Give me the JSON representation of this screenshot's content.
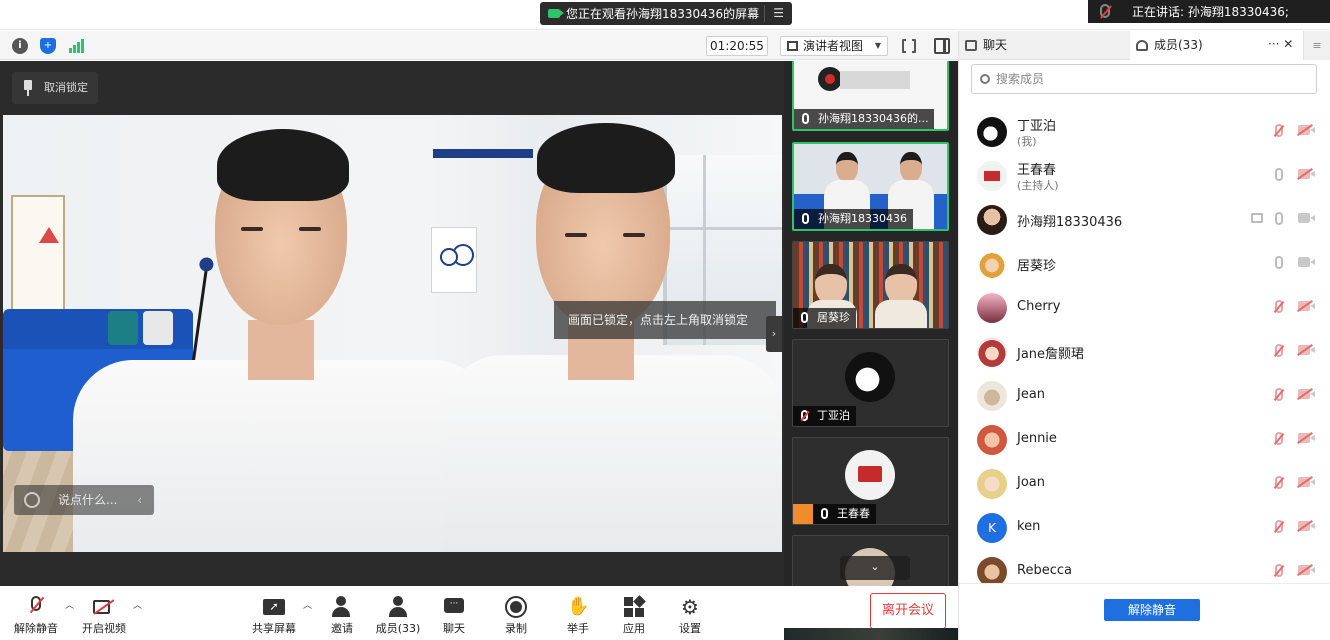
{
  "share_banner": {
    "text": "您正在观看孙海翔18330436的屏幕",
    "menu_icon": "menu-list-icon",
    "status_color": "#2ec46b"
  },
  "speaking": {
    "text": "正在讲话: 孙海翔18330436;"
  },
  "toolbar": {
    "timer": "01:20:55",
    "view_label": "演讲者视图"
  },
  "main_video": {
    "unlock_label": "取消锁定",
    "emoji_placeholder": "说点什么...",
    "lock_tip": "画面已锁定，点击左上角取消锁定"
  },
  "gallery": {
    "tiles": [
      {
        "name": "孙海翔18330436的..."
      },
      {
        "name": "孙海翔18330436"
      },
      {
        "name": "居葵珍"
      },
      {
        "name": "丁亚泊"
      },
      {
        "name": "王春春"
      }
    ]
  },
  "controls": {
    "unmute": "解除静音",
    "video": "开启视频",
    "share": "共享屏幕",
    "invite": "邀请",
    "members": "成员(33)",
    "chat": "聊天",
    "record": "录制",
    "raise_hand": "举手",
    "apps": "应用",
    "settings": "设置",
    "leave": "离开会议",
    "leave_color": "#e03b3b"
  },
  "side_panel": {
    "tab_chat": "聊天",
    "tab_members": "成员(33)",
    "more": "···",
    "close": "✕",
    "search_placeholder": "搜索成员",
    "unmute_all": "解除静音",
    "accent": "#1f6fe0",
    "members": [
      {
        "name": "丁亚泊",
        "sub": "(我)",
        "mic": "muted",
        "cam": "muted"
      },
      {
        "name": "王春春",
        "sub": "(主持人)",
        "mic": "on",
        "cam": "off"
      },
      {
        "name": "孙海翔18330436",
        "sub": "",
        "mic": "on",
        "cam": "off"
      },
      {
        "name": "居葵珍",
        "sub": "",
        "mic": "on",
        "cam": "off"
      },
      {
        "name": "Cherry",
        "sub": "",
        "mic": "muted",
        "cam": "muted"
      },
      {
        "name": "Jane詹颢珺",
        "sub": "",
        "mic": "muted",
        "cam": "muted"
      },
      {
        "name": "Jean",
        "sub": "",
        "mic": "muted",
        "cam": "muted"
      },
      {
        "name": "Jennie",
        "sub": "",
        "mic": "muted",
        "cam": "muted"
      },
      {
        "name": "Joan",
        "sub": "",
        "mic": "muted",
        "cam": "muted"
      },
      {
        "name": "ken",
        "sub": "",
        "mic": "muted",
        "cam": "muted",
        "initial": "K"
      },
      {
        "name": "Rebecca",
        "sub": "",
        "mic": "muted",
        "cam": "muted"
      }
    ]
  }
}
